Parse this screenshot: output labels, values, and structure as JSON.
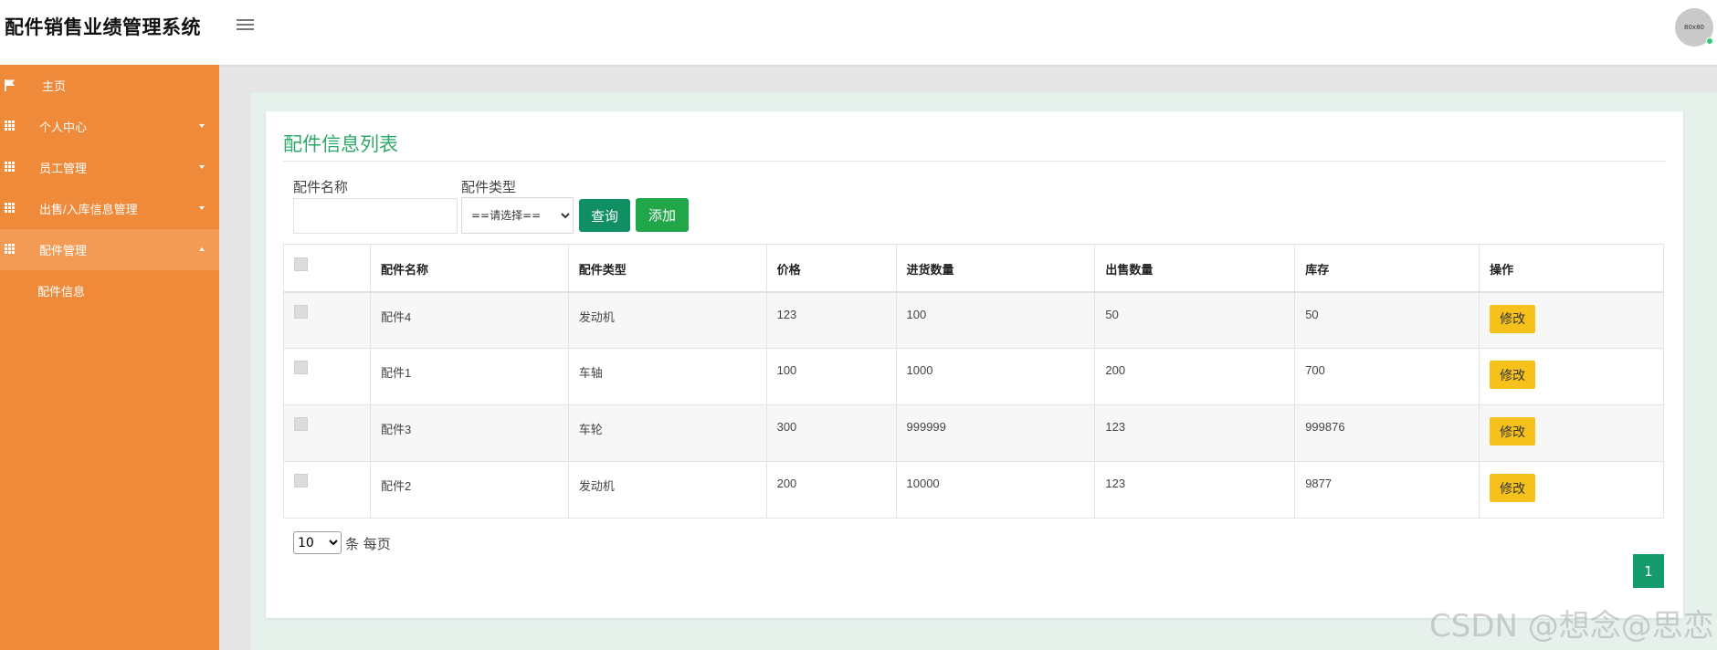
{
  "header": {
    "title": "配件销售业绩管理系统",
    "avatar_text": "80x80"
  },
  "sidebar": {
    "items": [
      {
        "label": "主页",
        "icon": "flag-icon"
      },
      {
        "label": "个人中心",
        "icon": "grid-icon"
      },
      {
        "label": "员工管理",
        "icon": "grid-icon"
      },
      {
        "label": "出售/入库信息管理",
        "icon": "grid-icon"
      },
      {
        "label": "配件管理",
        "icon": "grid-icon",
        "sub": "配件信息"
      }
    ]
  },
  "main": {
    "title": "配件信息列表",
    "search": {
      "name_label": "配件名称",
      "name_value": "",
      "type_label": "配件类型",
      "type_selected": "==请选择==",
      "query_button": "查询",
      "add_button": "添加"
    },
    "table": {
      "columns": [
        "配件名称",
        "配件类型",
        "价格",
        "进货数量",
        "出售数量",
        "库存",
        "操作"
      ],
      "rows": [
        [
          "配件4",
          "发动机",
          "123",
          "100",
          "50",
          "50"
        ],
        [
          "配件1",
          "车轴",
          "100",
          "1000",
          "200",
          "700"
        ],
        [
          "配件3",
          "车轮",
          "300",
          "999999",
          "123",
          "999876"
        ],
        [
          "配件2",
          "发动机",
          "200",
          "10000",
          "123",
          "9877"
        ]
      ],
      "edit_label": "修改"
    },
    "pagination": {
      "page_size": "10",
      "per_page_text": "条 每页",
      "current_page": "1"
    }
  },
  "watermark": "CSDN @想念@思恋",
  "colors": {
    "sidebar": "#ef8a3b",
    "title_green": "#2ea86a",
    "query_button": "#0f8f62",
    "add_button": "#21a64a",
    "edit_button": "#f5c11a",
    "page_active": "#159a6b"
  }
}
